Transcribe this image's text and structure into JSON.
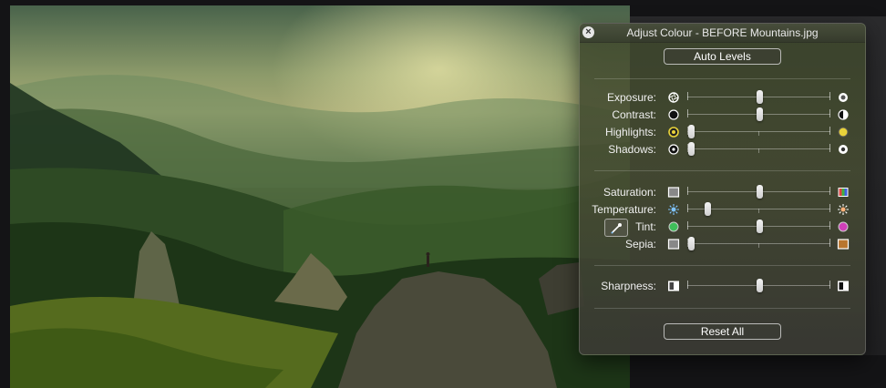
{
  "window": {
    "title": "Adjust Colour - BEFORE Mountains.jpg",
    "close_icon": "close-icon"
  },
  "buttons": {
    "auto_levels": "Auto Levels",
    "reset_all": "Reset All"
  },
  "sliders": {
    "exposure": {
      "label": "Exposure:",
      "value": 0.5,
      "left_icon": "aperture-closed-icon",
      "right_icon": "aperture-open-icon"
    },
    "contrast": {
      "label": "Contrast:",
      "value": 0.5,
      "left_icon": "filled-circle-icon",
      "right_icon": "half-circle-icon"
    },
    "highlights": {
      "label": "Highlights:",
      "value": 0.0,
      "left_icon": "yellow-ring-icon",
      "right_icon": "yellow-dot-icon"
    },
    "shadows": {
      "label": "Shadows:",
      "value": 0.0,
      "left_icon": "dark-dot-icon",
      "right_icon": "white-dot-icon"
    },
    "saturation": {
      "label": "Saturation:",
      "value": 0.5,
      "left_icon": "grey-swatch-icon",
      "right_icon": "color-swatch-icon"
    },
    "temperature": {
      "label": "Temperature:",
      "value": 0.12,
      "left_icon": "cold-sun-icon",
      "right_icon": "warm-sun-icon"
    },
    "tint": {
      "label": "Tint:",
      "value": 0.5,
      "left_icon": "green-circle-icon",
      "right_icon": "magenta-circle-icon"
    },
    "sepia": {
      "label": "Sepia:",
      "value": 0.0,
      "left_icon": "grey-swatch-icon",
      "right_icon": "sepia-swatch-icon"
    },
    "sharpness": {
      "label": "Sharpness:",
      "value": 0.5,
      "left_icon": "blurry-square-icon",
      "right_icon": "sharp-square-icon"
    }
  },
  "colors": {
    "highlight_yellow": "#e8d23a",
    "tint_green": "#3fbf5a",
    "tint_magenta": "#d040b8",
    "temperature_blue": "#7fc4ff",
    "panel_tint": "#3e482c"
  }
}
